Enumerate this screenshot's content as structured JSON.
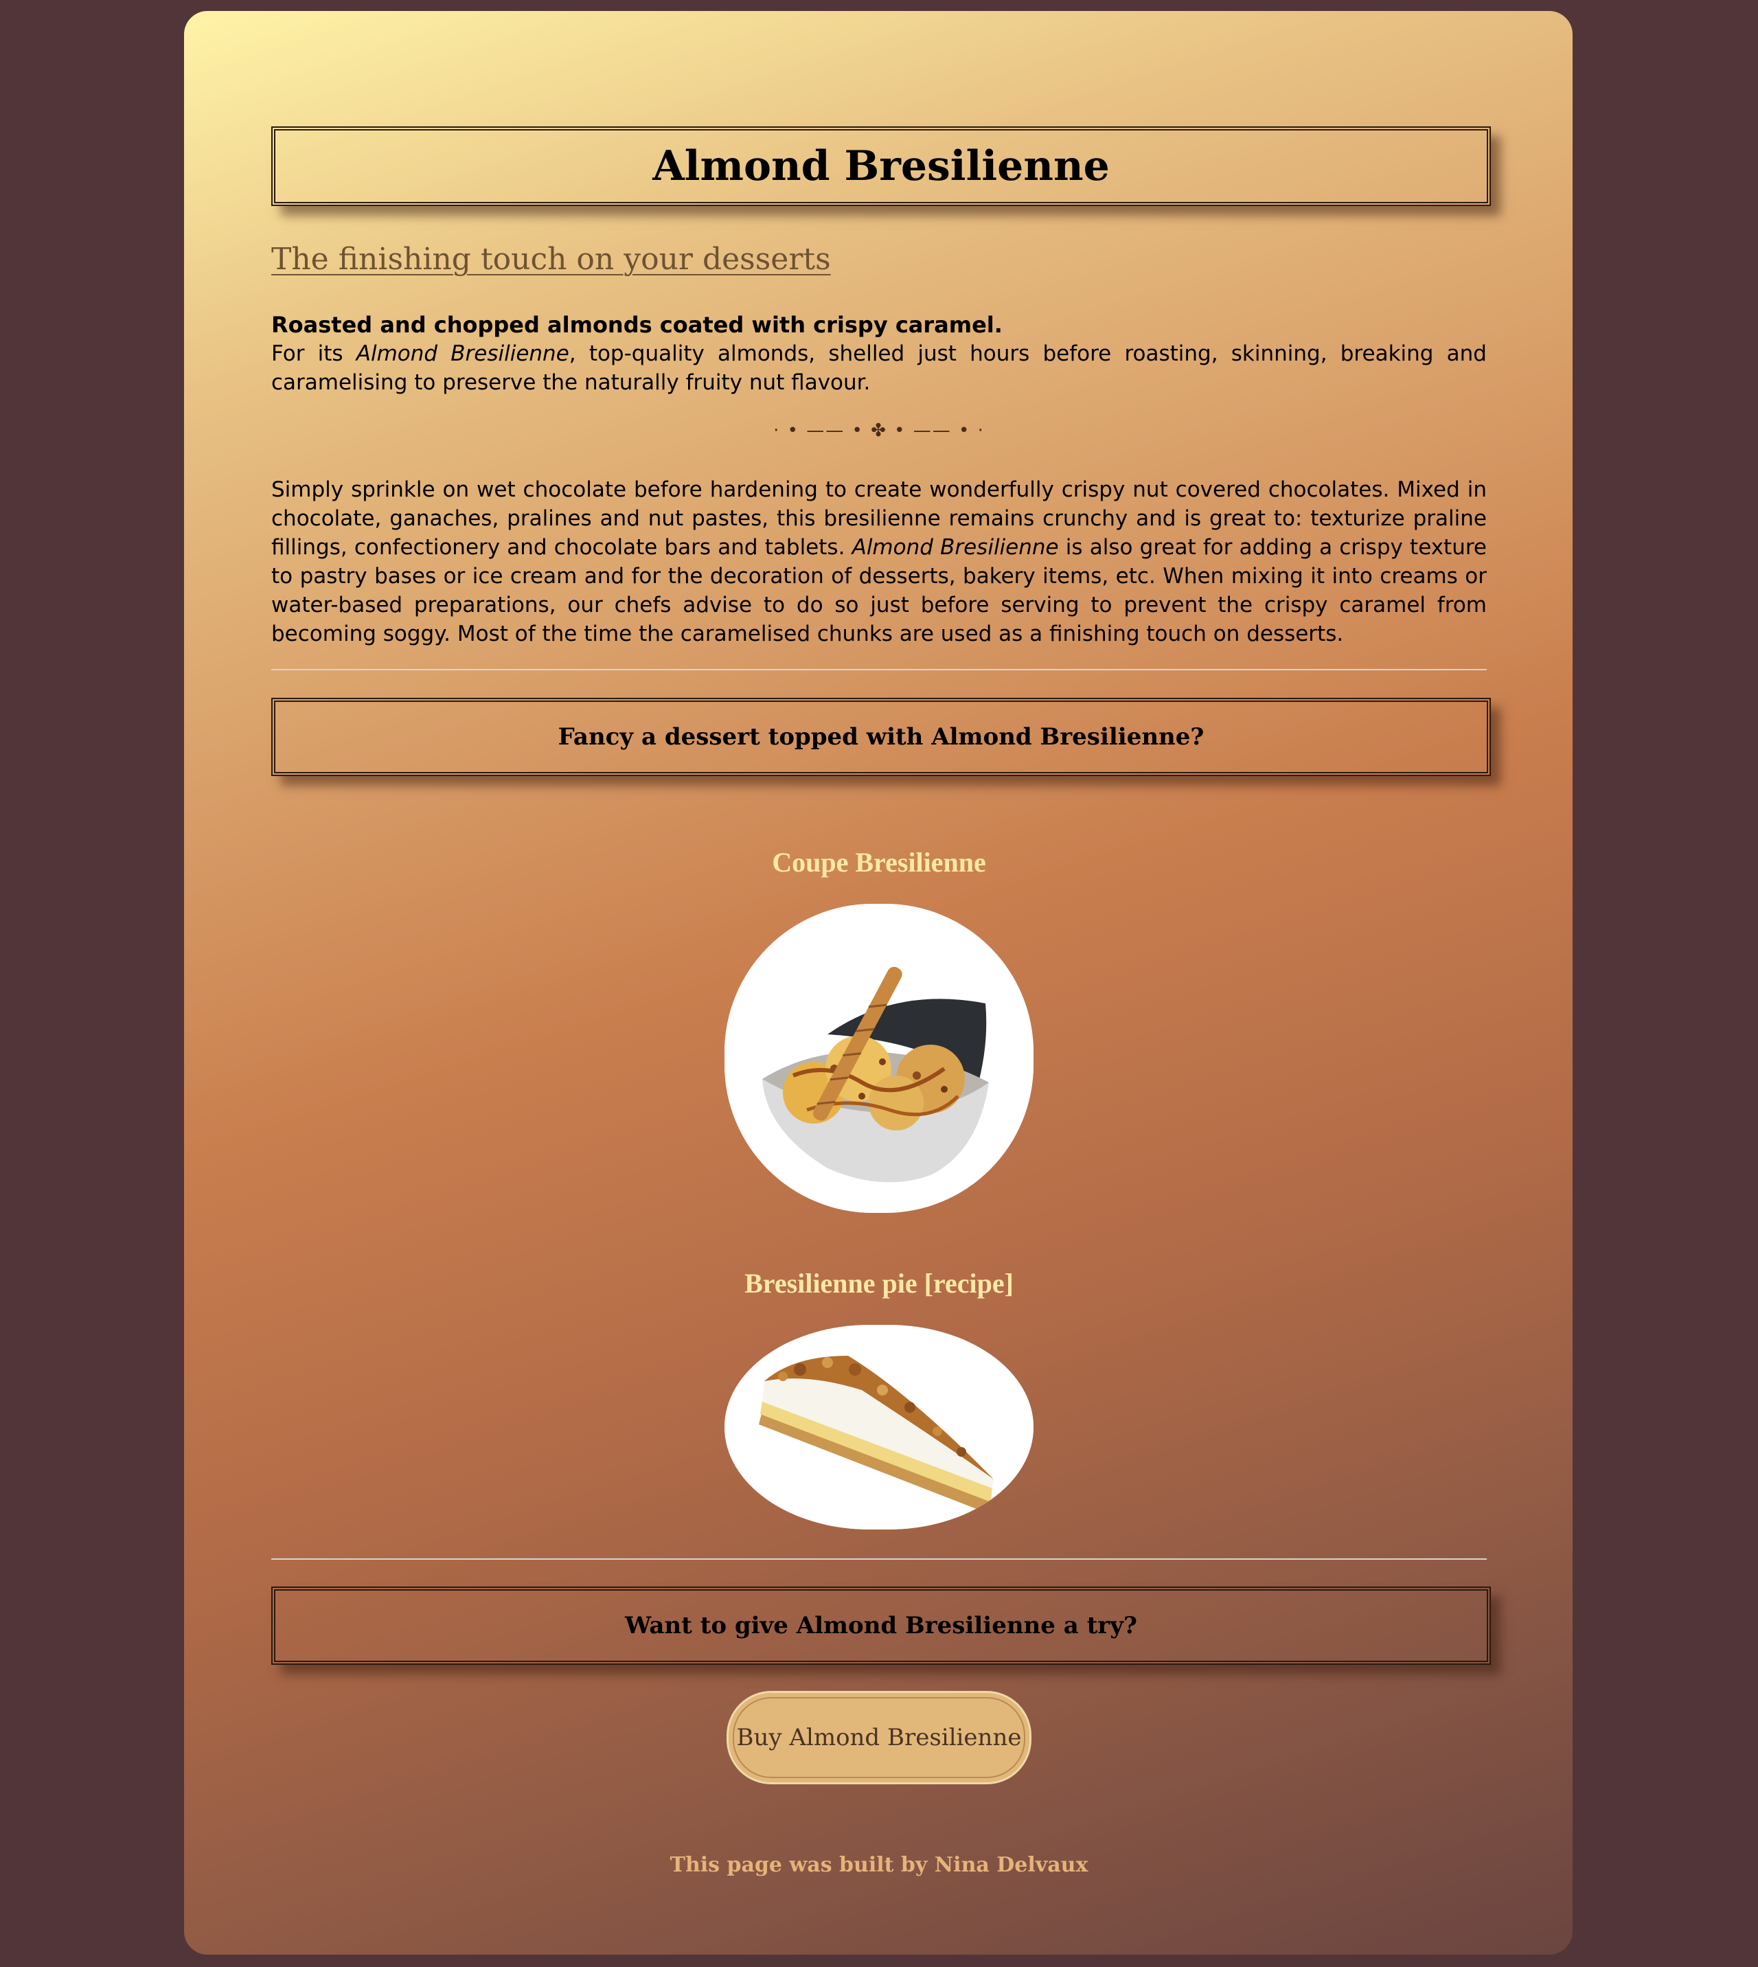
{
  "page": {
    "title": "Almond Bresilienne",
    "subtitle_link": "The finishing touch on your desserts"
  },
  "intro": {
    "lead": "Roasted and chopped almonds coated with crispy caramel.",
    "text_before": "For its ",
    "text_em": "Almond Bresilienne",
    "text_after": ", top-quality almonds, shelled just hours before roasting, skinning, breaking and caramelising to preserve the naturally fruity nut flavour."
  },
  "ornament": "· • —— • ✤ • —— • ·",
  "description": {
    "part1": "Simply sprinkle on wet chocolate before hardening to create wonderfully crispy nut covered chocolates. Mixed in chocolate, ganaches, pralines and nut pastes, this bresilienne remains crunchy and is great to: texturize praline fillings, confectionery and chocolate bars and tablets. ",
    "em": "Almond Bresilienne",
    "part2": " is also great for adding a crispy texture to pastry bases or ice cream and for the decoration of desserts, bakery items, etc. When mixing it into creams or water-based preparations, our chefs advise to do so just before serving to prevent the crispy caramel from becoming soggy. Most of the time the caramelised chunks are used as a finishing touch on desserts."
  },
  "desserts_section": {
    "heading": "Fancy a dessert topped with Almond Bresilienne?",
    "items": [
      {
        "title": "Coupe Bresilienne",
        "image": "coupe-bresilienne-photo"
      },
      {
        "title": "Bresilienne pie [recipe]",
        "image": "bresilienne-pie-photo"
      }
    ]
  },
  "cta_section": {
    "heading": "Want to give Almond Bresilienne a try?",
    "button_label": "Buy Almond Bresilienne"
  },
  "footer": {
    "text": "This page was built by Nina Delvaux"
  },
  "colors": {
    "page_background": "#523538",
    "gradient_start": "#fff4a8",
    "gradient_mid": "#c97e4e",
    "gradient_end": "#6a4540",
    "item_title": "#ffe9a6",
    "button_bg": "#e2b87a",
    "footer_text": "#e6b37a"
  }
}
